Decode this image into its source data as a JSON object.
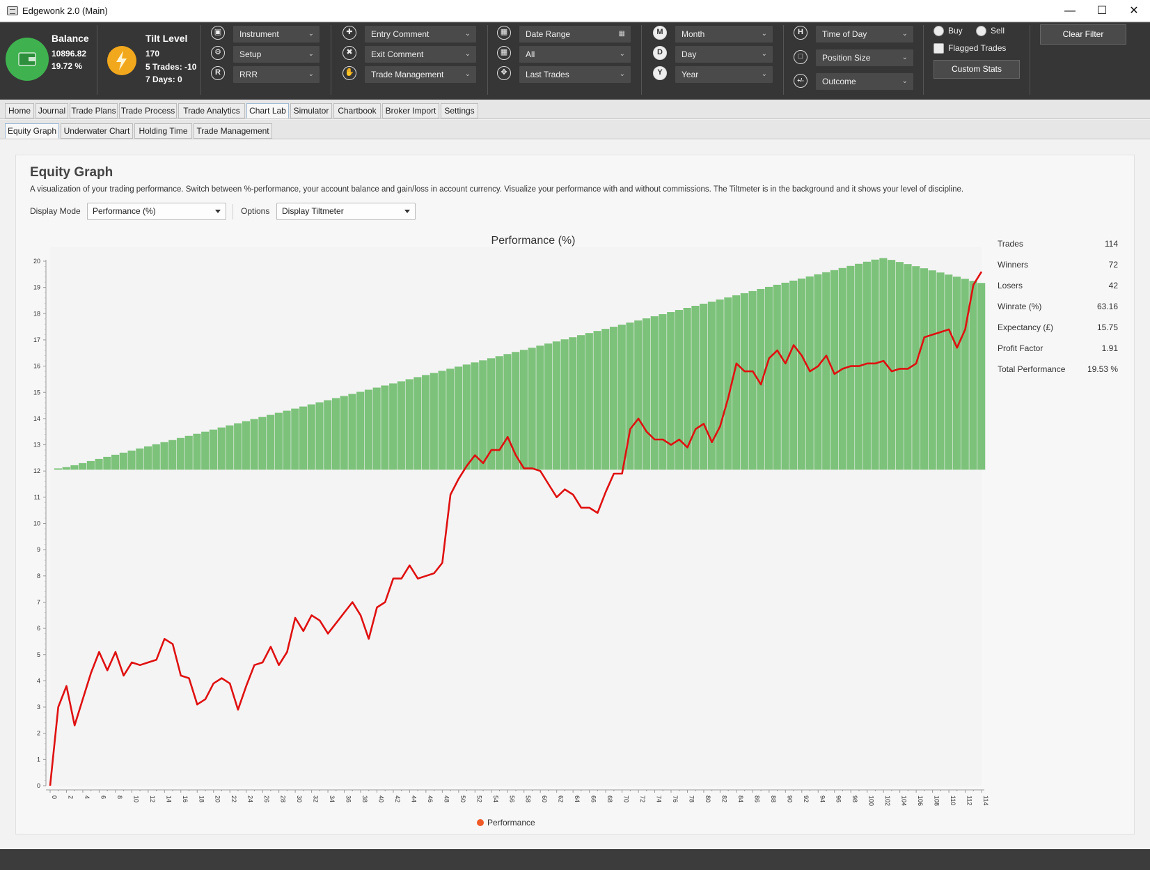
{
  "window": {
    "title": "Edgewonk 2.0 (Main)"
  },
  "account": {
    "balance_label": "Balance",
    "balance": "10896.82",
    "performance": "19.72 %"
  },
  "tilt": {
    "label": "Tilt Level",
    "value": "170",
    "five_trades": "5 Trades: -10",
    "seven_days": "7 Days: 0"
  },
  "filters": {
    "group1": [
      "Instrument",
      "Setup",
      "RRR"
    ],
    "group2": [
      "Entry Comment",
      "Exit Comment",
      "Trade Management"
    ],
    "group3": [
      "Date Range",
      "All",
      "Last Trades"
    ],
    "group4": [
      "Month",
      "Day",
      "Year"
    ],
    "group4_icons": [
      "M",
      "D",
      "Y"
    ],
    "group5": [
      "Time of Day",
      "Position Size",
      "Outcome"
    ],
    "group5_icons": [
      "H",
      "",
      "+/-"
    ],
    "buy_label": "Buy",
    "sell_label": "Sell",
    "flagged_label": "Flagged Trades",
    "custom_stats_label": "Custom Stats",
    "clear_filter_label": "Clear Filter",
    "rrr_icon": "R"
  },
  "main_tabs": [
    "Home",
    "Journal",
    "Trade Plans",
    "Trade Process",
    "Trade Analytics",
    "Chart Lab",
    "Simulator",
    "Chartbook",
    "Broker Import",
    "Settings"
  ],
  "sub_tabs": [
    "Equity Graph",
    "Underwater Chart",
    "Holding Time",
    "Trade Management"
  ],
  "panel": {
    "title": "Equity Graph",
    "description": "A visualization of your trading performance. Switch between %-performance, your account balance and gain/loss in account currency. Visualize your performance with and without commissions. The Tiltmeter is in the background and it shows your level of discipline.",
    "display_mode_label": "Display Mode",
    "display_mode_value": "Performance (%)",
    "options_label": "Options",
    "options_value": "Display Tiltmeter"
  },
  "stats": [
    {
      "label": "Trades",
      "value": "114"
    },
    {
      "label": "Winners",
      "value": "72"
    },
    {
      "label": "Losers",
      "value": "42"
    },
    {
      "label": "Winrate (%)",
      "value": "63.16"
    },
    {
      "label": "Expectancy (£)",
      "value": "15.75"
    },
    {
      "label": "Profit Factor",
      "value": "1.91"
    },
    {
      "label": "Total Performance",
      "value": "19.53 %"
    }
  ],
  "colors": {
    "toolbar": "#363636",
    "balance_circle": "#3fb24f",
    "tilt_circle": "#f2a81d",
    "tilt_bars": "#7dc27b",
    "line": "#e01010",
    "legend_dot": "#f05a28"
  },
  "chart_data": {
    "type": "line",
    "title": "Performance (%)",
    "x": [
      0,
      1,
      2,
      3,
      4,
      5,
      6,
      7,
      8,
      9,
      10,
      11,
      12,
      13,
      14,
      15,
      16,
      17,
      18,
      19,
      20,
      21,
      22,
      23,
      24,
      25,
      26,
      27,
      28,
      29,
      30,
      31,
      32,
      33,
      34,
      35,
      36,
      37,
      38,
      39,
      40,
      41,
      42,
      43,
      44,
      45,
      46,
      47,
      48,
      49,
      50,
      51,
      52,
      53,
      54,
      55,
      56,
      57,
      58,
      59,
      60,
      61,
      62,
      63,
      64,
      65,
      66,
      67,
      68,
      69,
      70,
      71,
      72,
      73,
      74,
      75,
      76,
      77,
      78,
      79,
      80,
      81,
      82,
      83,
      84,
      85,
      86,
      87,
      88,
      89,
      90,
      91,
      92,
      93,
      94,
      95,
      96,
      97,
      98,
      99,
      100,
      101,
      102,
      103,
      104,
      105,
      106,
      107,
      108,
      109,
      110,
      111,
      112,
      113,
      114
    ],
    "xticks": [
      0,
      2,
      4,
      6,
      8,
      10,
      12,
      14,
      16,
      18,
      20,
      22,
      24,
      26,
      28,
      30,
      32,
      34,
      36,
      38,
      40,
      42,
      44,
      46,
      48,
      50,
      52,
      54,
      56,
      58,
      60,
      62,
      64,
      66,
      68,
      70,
      72,
      74,
      76,
      78,
      80,
      82,
      84,
      86,
      88,
      90,
      92,
      94,
      96,
      98,
      100,
      102,
      104,
      106,
      108,
      110,
      112,
      114
    ],
    "ylim": [
      0,
      20
    ],
    "yticks": [
      0,
      1,
      2,
      3,
      4,
      5,
      6,
      7,
      8,
      9,
      10,
      11,
      12,
      13,
      14,
      15,
      16,
      17,
      18,
      19,
      20
    ],
    "series": [
      {
        "name": "Performance",
        "values": [
          0,
          3.0,
          3.8,
          2.3,
          3.3,
          4.3,
          5.1,
          4.4,
          5.1,
          4.2,
          4.7,
          4.6,
          4.7,
          4.8,
          5.6,
          5.4,
          4.2,
          4.1,
          3.1,
          3.3,
          3.9,
          4.1,
          3.9,
          2.9,
          3.8,
          4.6,
          4.7,
          5.3,
          4.6,
          5.1,
          6.4,
          5.9,
          6.5,
          6.3,
          5.8,
          6.2,
          6.6,
          7.0,
          6.5,
          5.6,
          6.8,
          7.0,
          7.9,
          7.9,
          8.4,
          7.9,
          8.0,
          8.1,
          8.5,
          11.1,
          11.7,
          12.2,
          12.6,
          12.3,
          12.8,
          12.8,
          13.3,
          12.6,
          12.1,
          12.1,
          12.0,
          11.5,
          11.0,
          11.3,
          11.1,
          10.6,
          10.6,
          10.4,
          11.2,
          11.9,
          11.9,
          13.6,
          14.0,
          13.5,
          13.2,
          13.2,
          13.0,
          13.2,
          12.9,
          13.6,
          13.8,
          13.1,
          13.7,
          14.8,
          16.1,
          15.8,
          15.8,
          15.3,
          16.3,
          16.6,
          16.1,
          16.8,
          16.4,
          15.8,
          16.0,
          16.4,
          15.7,
          15.9,
          16.0,
          16.0,
          16.1,
          16.1,
          16.2,
          15.8,
          15.9,
          15.9,
          16.1,
          17.1,
          17.2,
          17.3,
          17.4,
          16.7,
          17.4,
          19.1,
          19.6
        ]
      }
    ],
    "tiltmeter": {
      "from_x": 1,
      "to_x": 114,
      "baseline": 12.05,
      "values": [
        12.1,
        12.15,
        12.22,
        12.3,
        12.38,
        12.46,
        12.54,
        12.62,
        12.7,
        12.78,
        12.86,
        12.94,
        13.02,
        13.1,
        13.18,
        13.26,
        13.34,
        13.42,
        13.5,
        13.58,
        13.66,
        13.74,
        13.82,
        13.9,
        13.98,
        14.06,
        14.14,
        14.22,
        14.3,
        14.38,
        14.46,
        14.54,
        14.62,
        14.7,
        14.78,
        14.86,
        14.94,
        15.02,
        15.1,
        15.18,
        15.26,
        15.34,
        15.42,
        15.5,
        15.58,
        15.66,
        15.74,
        15.82,
        15.9,
        15.98,
        16.06,
        16.14,
        16.22,
        16.3,
        16.38,
        16.46,
        16.54,
        16.62,
        16.7,
        16.78,
        16.86,
        16.94,
        17.02,
        17.1,
        17.18,
        17.26,
        17.34,
        17.42,
        17.5,
        17.58,
        17.66,
        17.74,
        17.82,
        17.9,
        17.98,
        18.06,
        18.14,
        18.22,
        18.3,
        18.38,
        18.46,
        18.54,
        18.62,
        18.7,
        18.78,
        18.86,
        18.94,
        19.02,
        19.1,
        19.18,
        19.26,
        19.34,
        19.42,
        19.5,
        19.58,
        19.66,
        19.74,
        19.82,
        19.9,
        19.98,
        20.06,
        20.12,
        20.05,
        19.97,
        19.89,
        19.81,
        19.73,
        19.65,
        19.57,
        19.49,
        19.41,
        19.33,
        19.25,
        19.17
      ],
      "shown": true
    },
    "legend": [
      "Performance"
    ],
    "legend_position": "bottom-center",
    "grid": false
  }
}
